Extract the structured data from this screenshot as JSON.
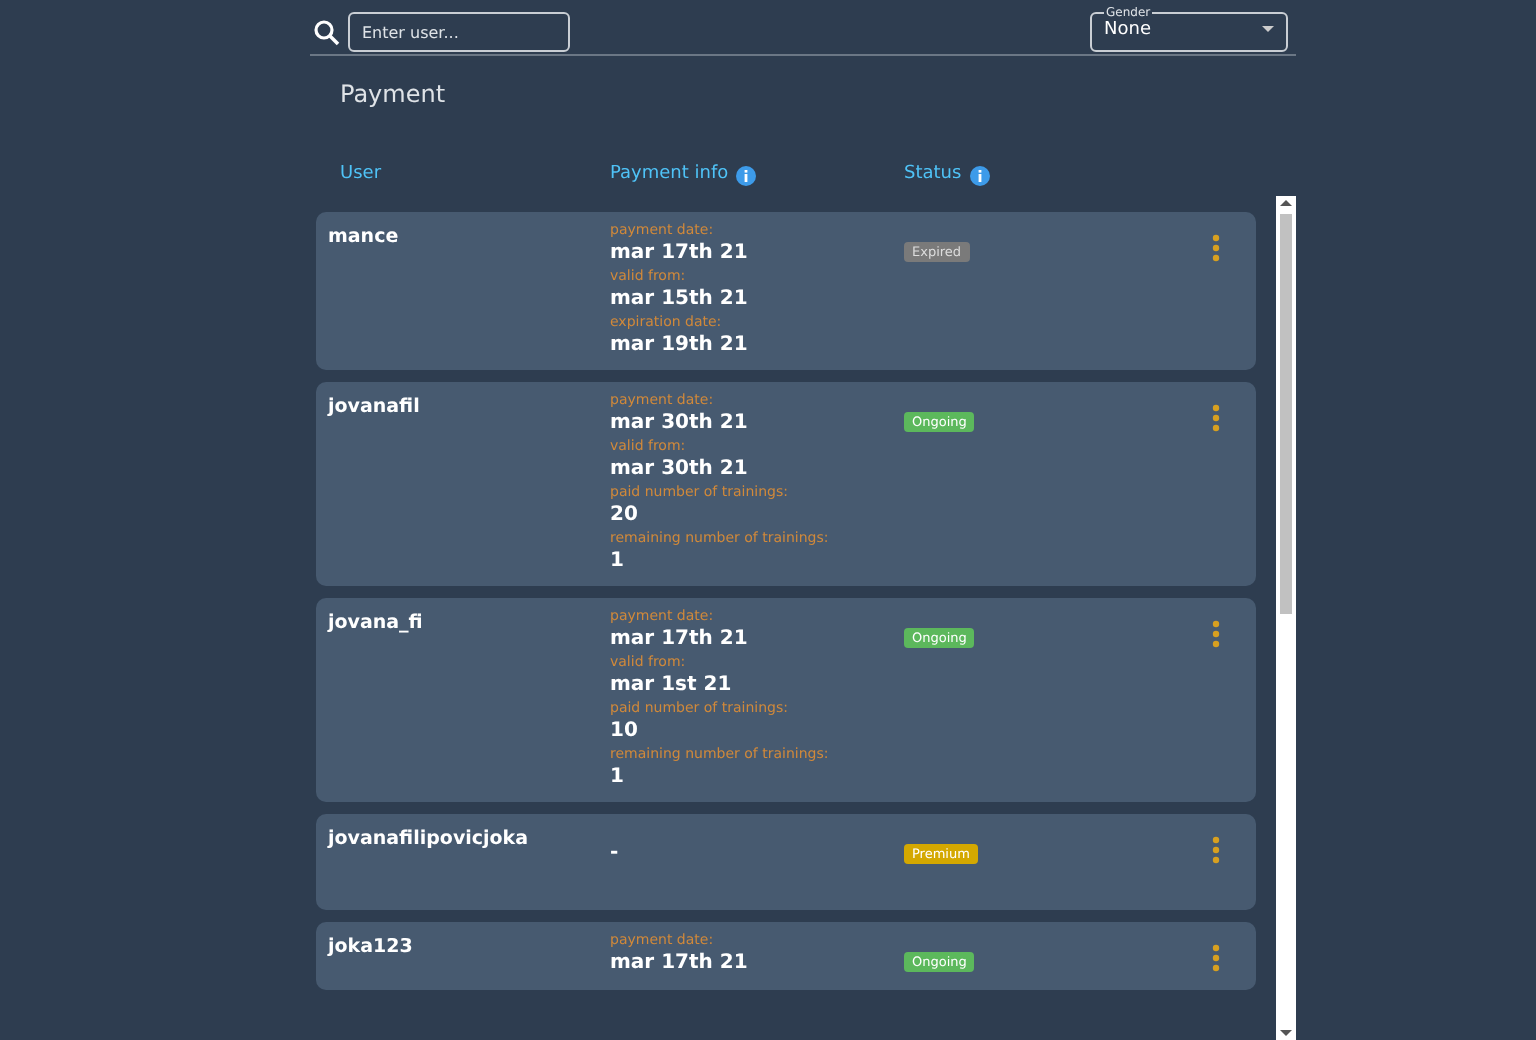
{
  "search": {
    "placeholder": "Enter user..."
  },
  "gender_select": {
    "label": "Gender",
    "value": "None"
  },
  "title": "Payment",
  "columns": [
    {
      "label": "User",
      "info": false
    },
    {
      "label": "Payment info",
      "info": true
    },
    {
      "label": "Status",
      "info": true
    }
  ],
  "rows": [
    {
      "user": "mance",
      "info": [
        {
          "label": "payment date:",
          "value": "mar 17th 21"
        },
        {
          "label": "valid from:",
          "value": "mar 15th 21"
        },
        {
          "label": "expiration date:",
          "value": "mar 19th 21"
        }
      ],
      "status": {
        "kind": "expired",
        "text": "Expired"
      }
    },
    {
      "user": "jovanafil",
      "info": [
        {
          "label": "payment date:",
          "value": "mar 30th 21"
        },
        {
          "label": "valid from:",
          "value": "mar 30th 21"
        },
        {
          "label": "paid number of trainings:",
          "value": "20"
        },
        {
          "label": "remaining number of trainings:",
          "value": "1"
        }
      ],
      "status": {
        "kind": "ongoing",
        "text": "Ongoing"
      }
    },
    {
      "user": "jovana_fi",
      "info": [
        {
          "label": "payment date:",
          "value": "mar 17th 21"
        },
        {
          "label": "valid from:",
          "value": "mar 1st 21"
        },
        {
          "label": "paid number of trainings:",
          "value": "10"
        },
        {
          "label": "remaining number of trainings:",
          "value": "1"
        }
      ],
      "status": {
        "kind": "ongoing",
        "text": "Ongoing"
      }
    },
    {
      "user": "jovanafilipovicjoka",
      "empty_info": "-",
      "info": [],
      "status": {
        "kind": "premium",
        "text": "Premium"
      }
    },
    {
      "user": "joka123",
      "info": [
        {
          "label": "payment date:",
          "value": "mar 17th 21"
        }
      ],
      "status": {
        "kind": "ongoing",
        "text": "Ongoing"
      }
    }
  ]
}
